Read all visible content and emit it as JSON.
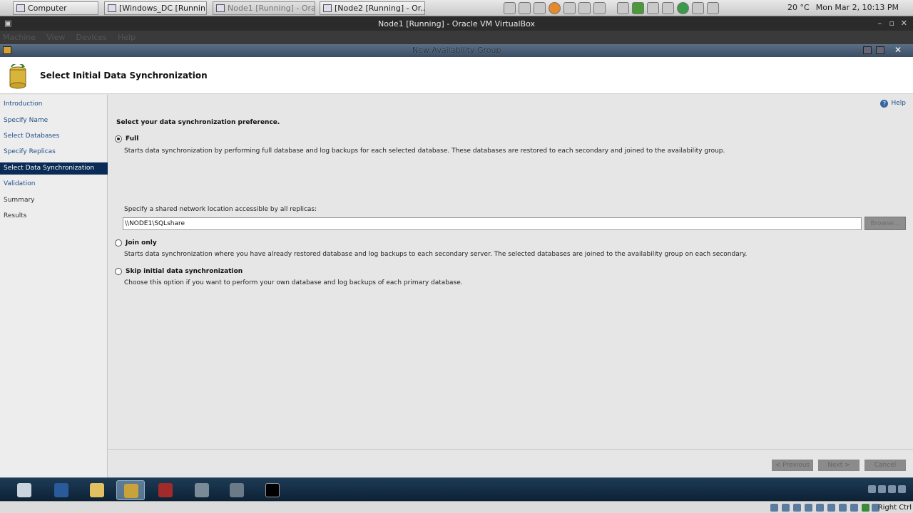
{
  "host": {
    "tabs": [
      {
        "label": "Computer"
      },
      {
        "label": "[Windows_DC [Runnin..."
      },
      {
        "label": "Node1 [Running] - Ora"
      },
      {
        "label": "[Node2 [Running] - Or..."
      }
    ],
    "temperature": "20 °C",
    "clock": "Mon Mar 2, 10:13 PM"
  },
  "vbox": {
    "title": "Node1 [Running] - Oracle VM VirtualBox",
    "menu": [
      "Machine",
      "View",
      "Devices",
      "Help"
    ],
    "host_key": "Right Ctrl"
  },
  "wizard": {
    "window_title": "New Availability Group",
    "page_title": "Select Initial Data Synchronization",
    "help_label": "Help",
    "nav": [
      {
        "label": "Introduction"
      },
      {
        "label": "Specify Name"
      },
      {
        "label": "Select Databases"
      },
      {
        "label": "Specify Replicas"
      },
      {
        "label": "Select Data Synchronization"
      },
      {
        "label": "Validation"
      },
      {
        "label": "Summary"
      },
      {
        "label": "Results"
      }
    ],
    "selected_nav": "Select Data Synchronization",
    "prompt": "Select your data synchronization preference.",
    "options": [
      {
        "label": "Full",
        "selected": true,
        "desc": "Starts data synchronization by performing full database and log backups for each selected database. These databases are restored to each secondary and joined to the availability group."
      },
      {
        "label": "Join only",
        "selected": false,
        "desc": "Starts data synchronization where you have already restored database and log backups to each secondary server. The selected databases are joined to the availability group on each secondary."
      },
      {
        "label": "Skip initial data synchronization",
        "selected": false,
        "desc": "Choose this option if you want to perform your own database and log backups of each primary database."
      }
    ],
    "share_label": "Specify a shared network location accessible by all replicas:",
    "share_value": "\\\\NODE1\\SQLshare",
    "browse_label": "Browse...",
    "buttons": {
      "previous": "< Previous",
      "next": "Next >",
      "cancel": "Cancel"
    }
  }
}
